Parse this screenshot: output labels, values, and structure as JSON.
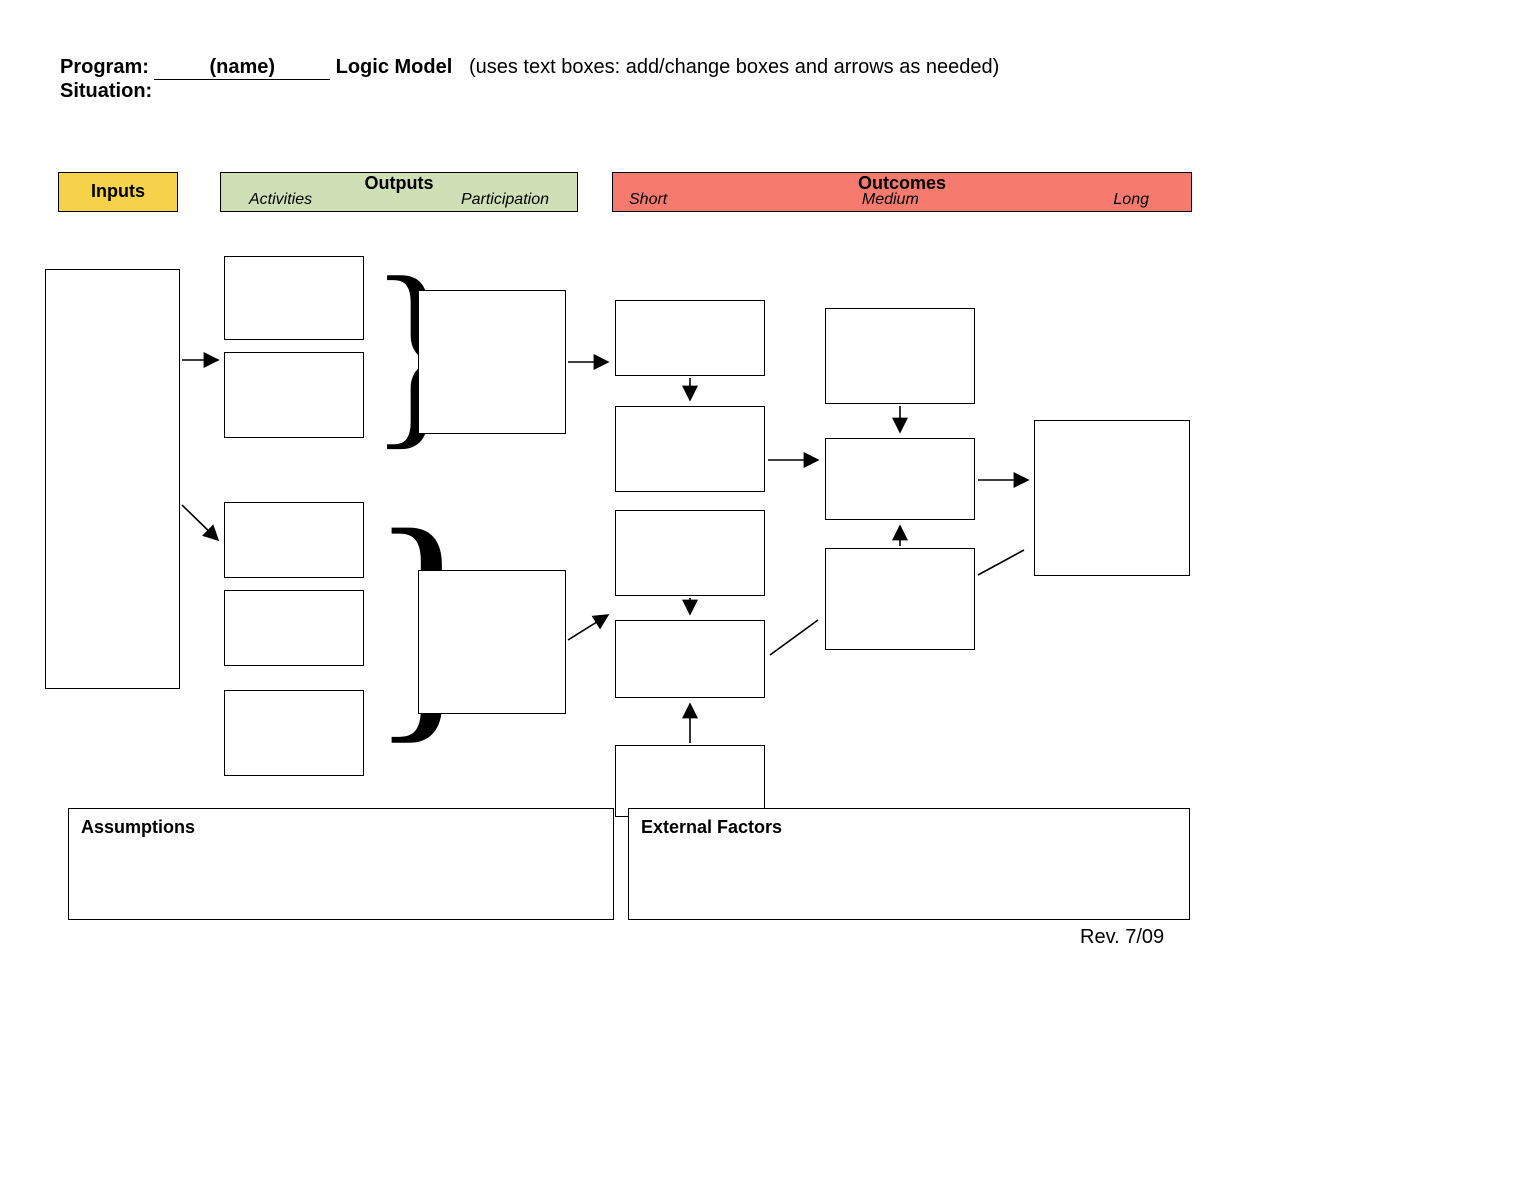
{
  "header": {
    "program_label": "Program:",
    "program_name": "(name)",
    "model_label": "Logic Model",
    "hint": "(uses text boxes: add/change boxes and arrows as needed)",
    "situation_label": "Situation:"
  },
  "columns": {
    "inputs": "Inputs",
    "outputs": "Outputs",
    "outputs_sub1": "Activities",
    "outputs_sub2": "Participation",
    "outcomes": "Outcomes",
    "outcomes_sub1": "Short",
    "outcomes_sub2": "Medium",
    "outcomes_sub3": "Long"
  },
  "footer": {
    "assumptions": "Assumptions",
    "external": "External Factors",
    "rev": "Rev. 7/09"
  },
  "colors": {
    "inputs_bg": "#f6d24a",
    "outputs_bg": "#cfe0b6",
    "outcomes_bg": "#f67a6d"
  }
}
